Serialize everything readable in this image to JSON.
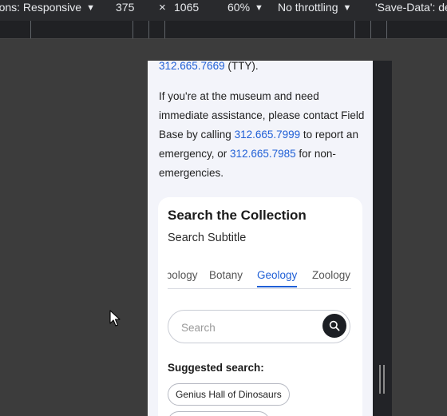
{
  "devtools": {
    "dimensions_label": "Dimensions: Responsive",
    "width_value": "375",
    "times_symbol": "×",
    "height_value": "1065",
    "zoom": "60%",
    "throttling": "No throttling",
    "save_data": "'Save-Data': default"
  },
  "page": {
    "tty_phone": "312.665.7669",
    "tty_suffix": " (TTY).",
    "para_intro": "If you're at the museum and need immediate assistance, please contact Field Base by calling ",
    "emergency_phone": "312.665.7999",
    "para_mid": " to report an emergency, or ",
    "non_emergency_phone": "312.665.7985",
    "para_end": " for non-emergencies."
  },
  "search_card": {
    "title": "Search the Collection",
    "subtitle": "Search Subtitle",
    "tabs": [
      {
        "label": "Anthropology"
      },
      {
        "label": "Botany"
      },
      {
        "label": "Geology"
      },
      {
        "label": "Zoology"
      }
    ],
    "active_tab": "Geology",
    "search_placeholder": "Search",
    "suggested_label": "Suggested search:",
    "chips": [
      {
        "label": "Genius Hall of Dinosaurs"
      },
      {
        "label": ""
      }
    ]
  },
  "colors": {
    "link": "#1f5fd6",
    "page_bg": "#f3f4fa",
    "devtools_bg": "#292a2d"
  }
}
